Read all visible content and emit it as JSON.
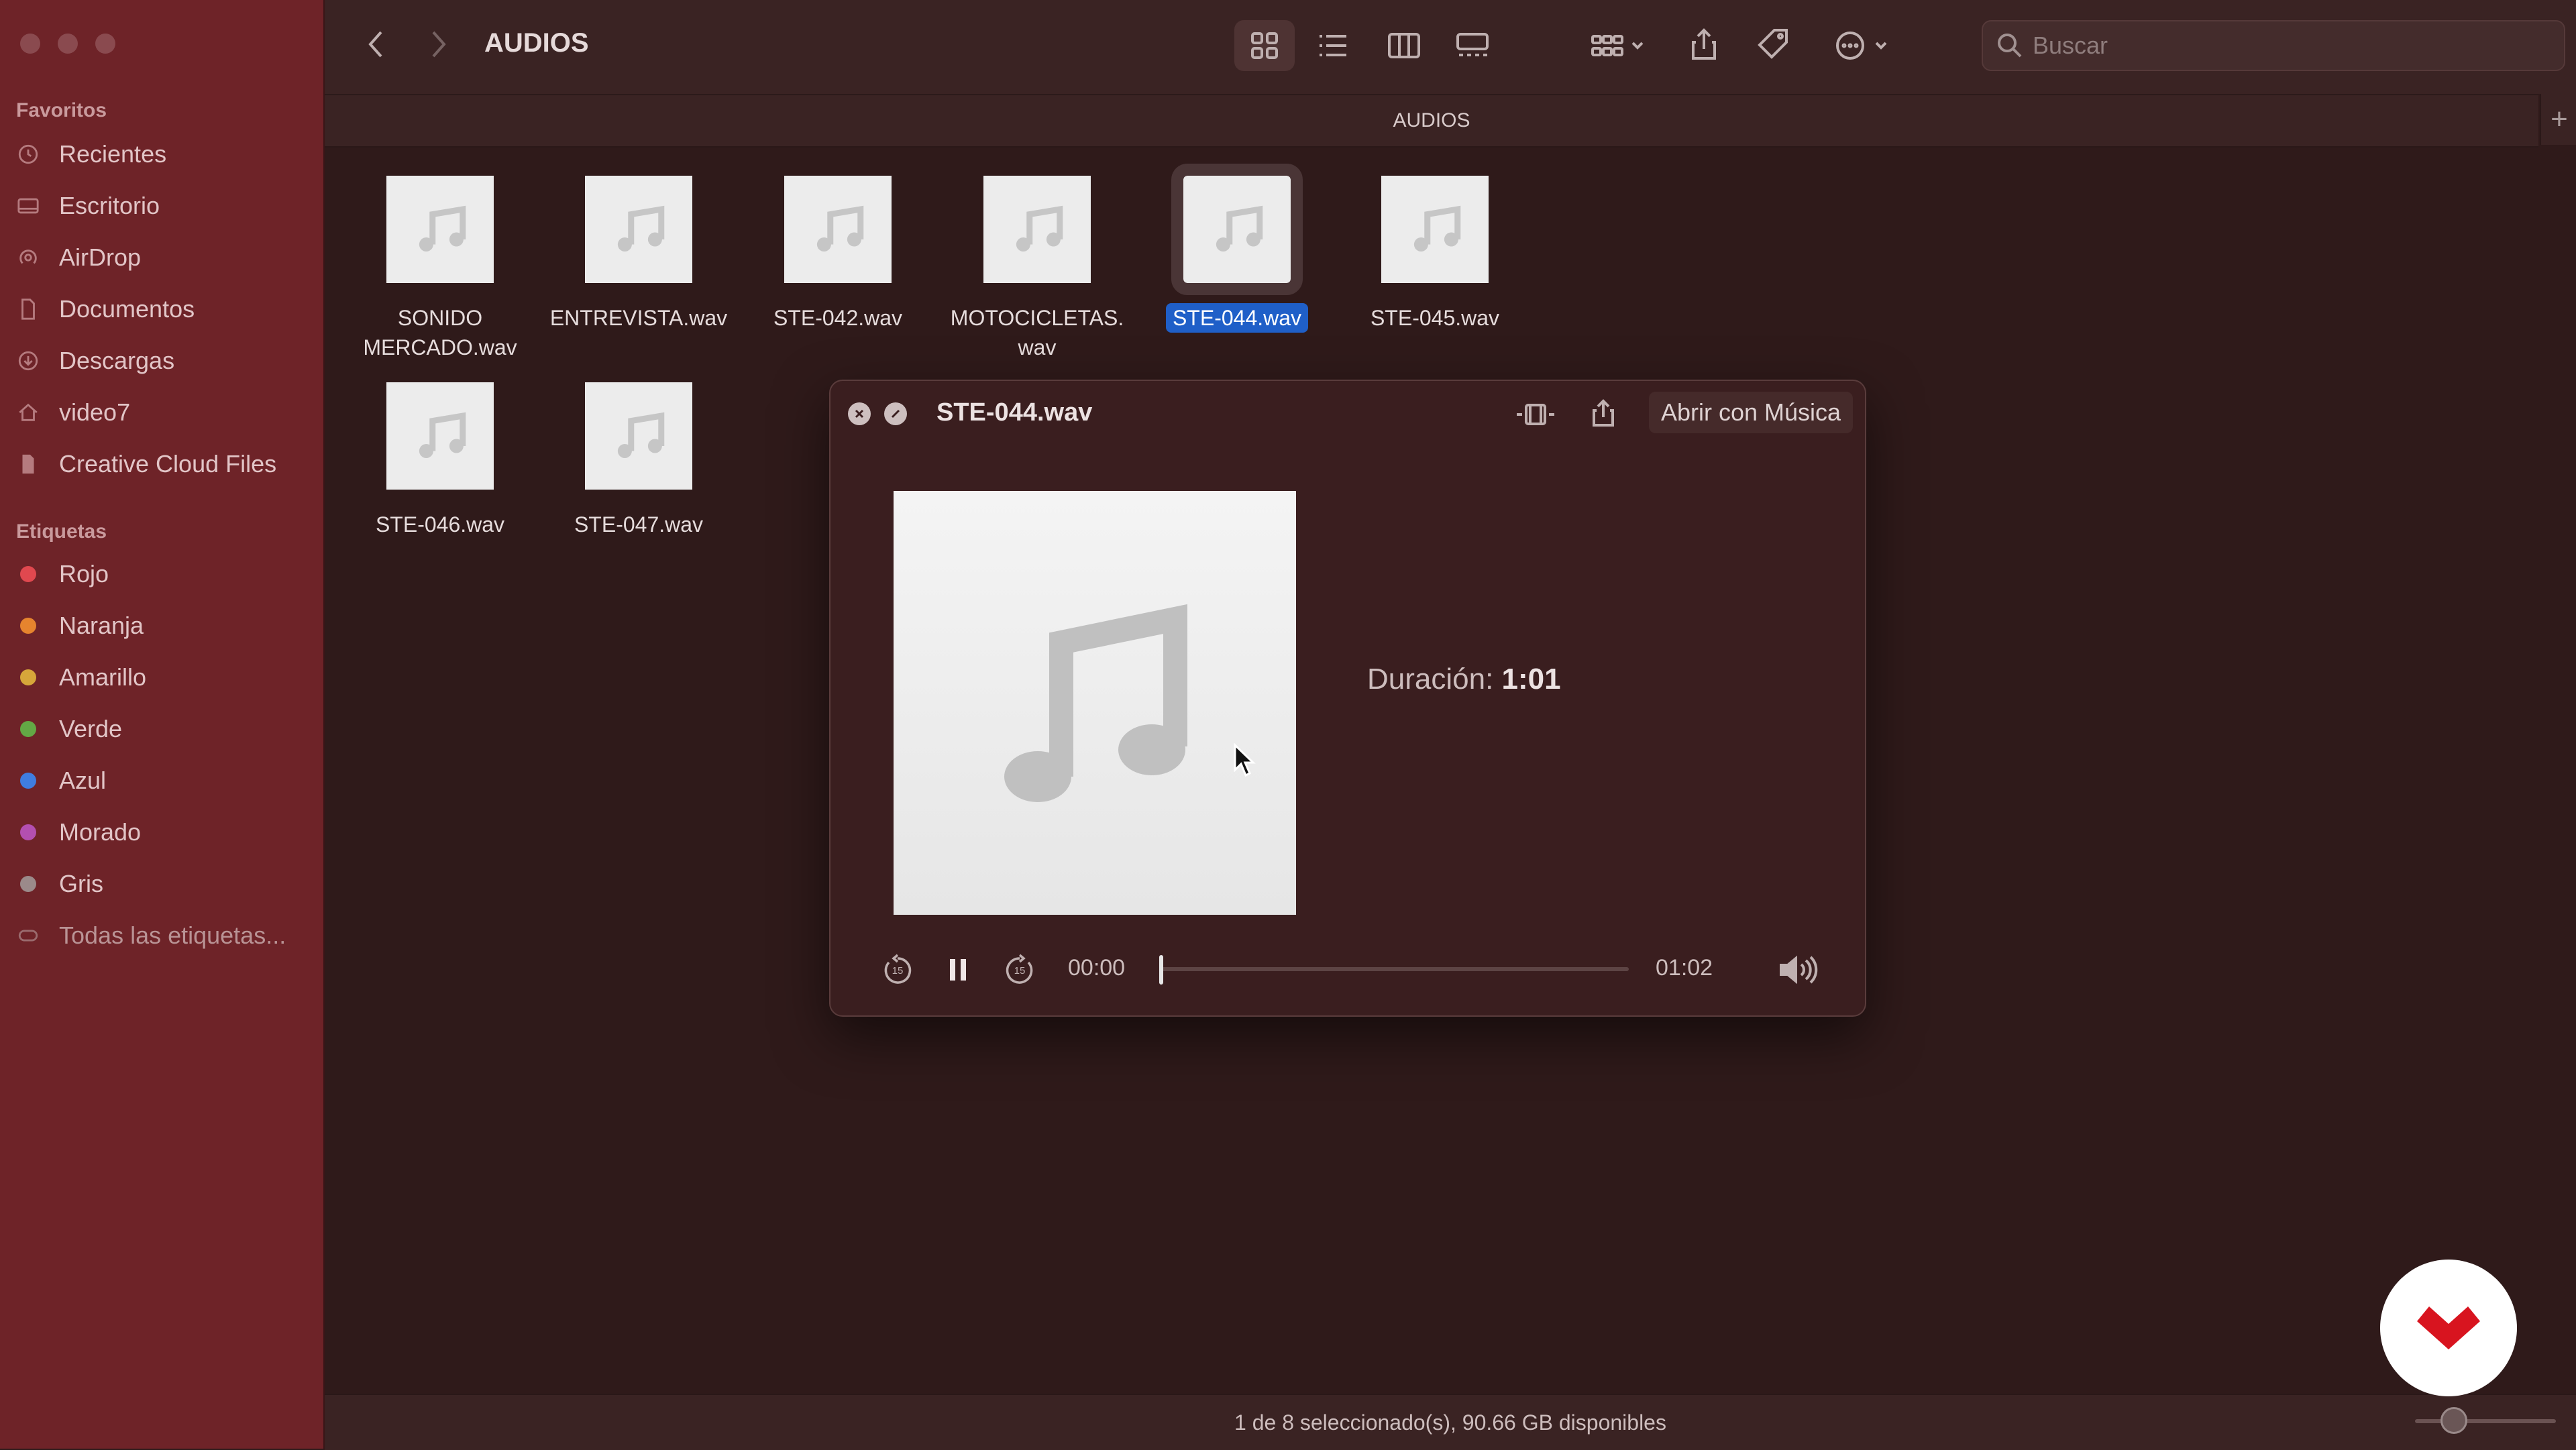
{
  "sidebar": {
    "favorites_title": "Favoritos",
    "favorites": [
      {
        "label": "Recientes",
        "icon": "clock-icon"
      },
      {
        "label": "Escritorio",
        "icon": "desktop-icon"
      },
      {
        "label": "AirDrop",
        "icon": "airdrop-icon"
      },
      {
        "label": "Documentos",
        "icon": "document-icon"
      },
      {
        "label": "Descargas",
        "icon": "download-icon"
      },
      {
        "label": "video7",
        "icon": "home-icon"
      },
      {
        "label": "Creative Cloud Files",
        "icon": "file-icon"
      }
    ],
    "tags_title": "Etiquetas",
    "tags": [
      {
        "label": "Rojo",
        "color": "#e0484f"
      },
      {
        "label": "Naranja",
        "color": "#e6842e"
      },
      {
        "label": "Amarillo",
        "color": "#d6a63a"
      },
      {
        "label": "Verde",
        "color": "#63a845"
      },
      {
        "label": "Azul",
        "color": "#3f7de0"
      },
      {
        "label": "Morado",
        "color": "#b34fb0"
      },
      {
        "label": "Gris",
        "color": "#9b8a8a"
      },
      {
        "label": "Todas las etiquetas...",
        "color": ""
      }
    ]
  },
  "toolbar": {
    "title": "AUDIOS",
    "search_placeholder": "Buscar"
  },
  "pathbar": {
    "title": "AUDIOS"
  },
  "files": [
    {
      "name": "SONIDO MERCADO.wav",
      "selected": false
    },
    {
      "name": "ENTREVISTA.wav",
      "selected": false
    },
    {
      "name": "STE-042.wav",
      "selected": false
    },
    {
      "name": "MOTOCICLETAS. wav",
      "selected": false
    },
    {
      "name": "STE-044.wav",
      "selected": true
    },
    {
      "name": "STE-045.wav",
      "selected": false
    },
    {
      "name": "STE-046.wav",
      "selected": false
    },
    {
      "name": "STE-047.wav",
      "selected": false
    }
  ],
  "quicklook": {
    "title": "STE-044.wav",
    "open_with": "Abrir con Música",
    "duration_label": "Duración:",
    "duration_value": "1:01",
    "time_current": "00:00",
    "time_total": "01:02",
    "progress": 0
  },
  "status": {
    "text": "1 de 8 seleccionado(s), 90.66 GB disponibles"
  },
  "colors": {
    "selection": "#1f5fc8",
    "sidebar": "#6e2328",
    "window": "#2f1a1a"
  }
}
